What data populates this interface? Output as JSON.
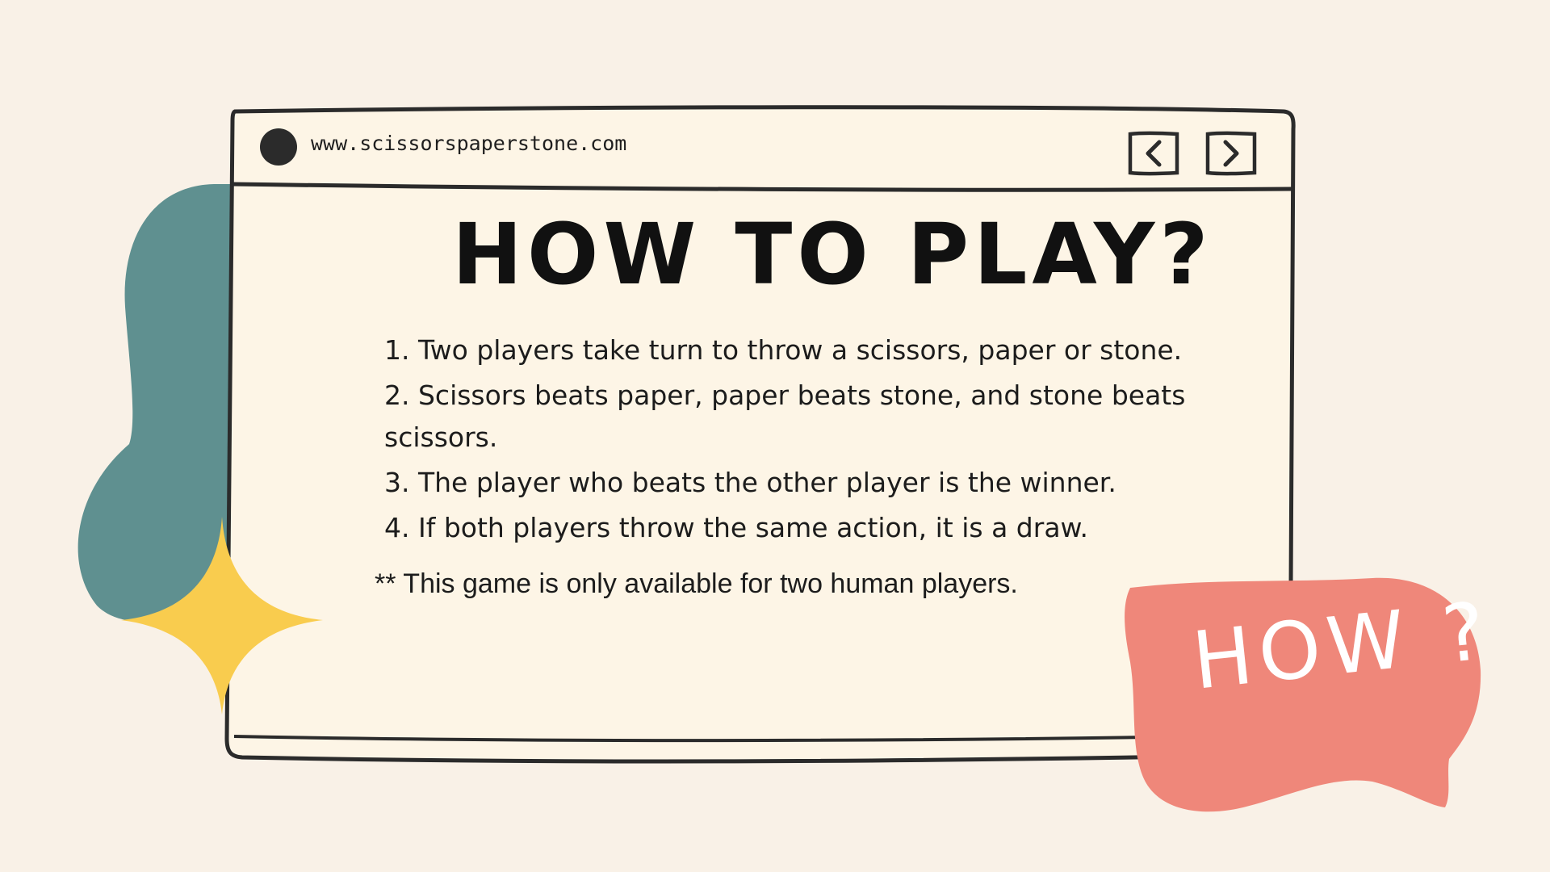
{
  "browser": {
    "url": "www.scissorspaperstone.com"
  },
  "content": {
    "title": "HOW TO PLAY?",
    "rules": [
      "1. Two players take turn to throw a scissors, paper or stone.",
      "2. Scissors beats paper, paper beats stone, and stone beats scissors.",
      "3. The player who beats the other player is the winner.",
      "4. If both players throw the same action, it is a draw."
    ],
    "note": "** This game is only available for two human players."
  },
  "badge": {
    "text": "HOW ?"
  },
  "icons": {
    "back": "chevron-left-icon",
    "forward": "chevron-right-icon",
    "dot": "circle-dot-icon",
    "sparkle": "four-point-star-icon",
    "bubble": "speech-bubble-icon"
  },
  "colors": {
    "background": "#f9f1e7",
    "window": "#fdf5e6",
    "outline": "#2b2b2b",
    "teal_blob": "#5f9090",
    "yellow_sparkle": "#f9cc4e",
    "pink_bubble": "#ef877a"
  }
}
